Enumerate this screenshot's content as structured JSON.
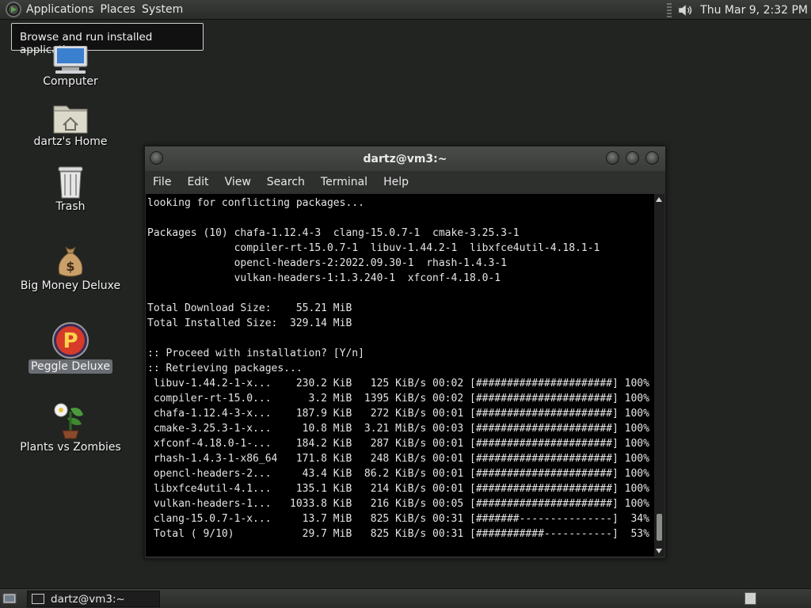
{
  "top_panel": {
    "menus": [
      "Applications",
      "Places",
      "System"
    ],
    "clock": "Thu Mar  9,  2:32 PM",
    "icons": {
      "menu": "gnome-foot-icon",
      "volume": "speaker-icon"
    }
  },
  "tooltip": "Browse and run installed applications",
  "desktop": {
    "icons": [
      {
        "label": "Computer",
        "icon": "computer-icon"
      },
      {
        "label": "dartz's Home",
        "icon": "home-folder-icon"
      },
      {
        "label": "Trash",
        "icon": "trash-icon"
      },
      {
        "label": "Big Money Deluxe",
        "icon": "money-bag-icon"
      },
      {
        "label": "Peggle Deluxe",
        "icon": "peggle-icon",
        "selected": true
      },
      {
        "label": "Plants vs Zombies",
        "icon": "plants-icon"
      }
    ]
  },
  "terminal": {
    "title": "dartz@vm3:~",
    "menu": [
      "File",
      "Edit",
      "View",
      "Search",
      "Terminal",
      "Help"
    ],
    "lines": [
      "looking for conflicting packages...",
      "",
      "Packages (10) chafa-1.12.4-3  clang-15.0.7-1  cmake-3.25.3-1",
      "              compiler-rt-15.0.7-1  libuv-1.44.2-1  libxfce4util-4.18.1-1",
      "              opencl-headers-2:2022.09.30-1  rhash-1.4.3-1",
      "              vulkan-headers-1:1.3.240-1  xfconf-4.18.0-1",
      "",
      "Total Download Size:    55.21 MiB",
      "Total Installed Size:  329.14 MiB",
      "",
      ":: Proceed with installation? [Y/n]",
      ":: Retrieving packages...",
      " libuv-1.44.2-1-x...    230.2 KiB   125 KiB/s 00:02 [######################] 100%",
      " compiler-rt-15.0...      3.2 MiB  1395 KiB/s 00:02 [######################] 100%",
      " chafa-1.12.4-3-x...    187.9 KiB   272 KiB/s 00:01 [######################] 100%",
      " cmake-3.25.3-1-x...     10.8 MiB  3.21 MiB/s 00:03 [######################] 100%",
      " xfconf-4.18.0-1-...    184.2 KiB   287 KiB/s 00:01 [######################] 100%",
      " rhash-1.4.3-1-x86_64   171.8 KiB   248 KiB/s 00:01 [######################] 100%",
      " opencl-headers-2...     43.4 KiB  86.2 KiB/s 00:01 [######################] 100%",
      " libxfce4util-4.1...    135.1 KiB   214 KiB/s 00:01 [######################] 100%",
      " vulkan-headers-1...   1033.8 KiB   216 KiB/s 00:05 [######################] 100%",
      " clang-15.0.7-1-x...     13.7 MiB   825 KiB/s 00:31 [#######---------------]  34%",
      " Total ( 9/10)           29.7 MiB   825 KiB/s 00:31 [###########-----------]  53%"
    ]
  },
  "taskbar": {
    "task_label": "dartz@vm3:~"
  }
}
